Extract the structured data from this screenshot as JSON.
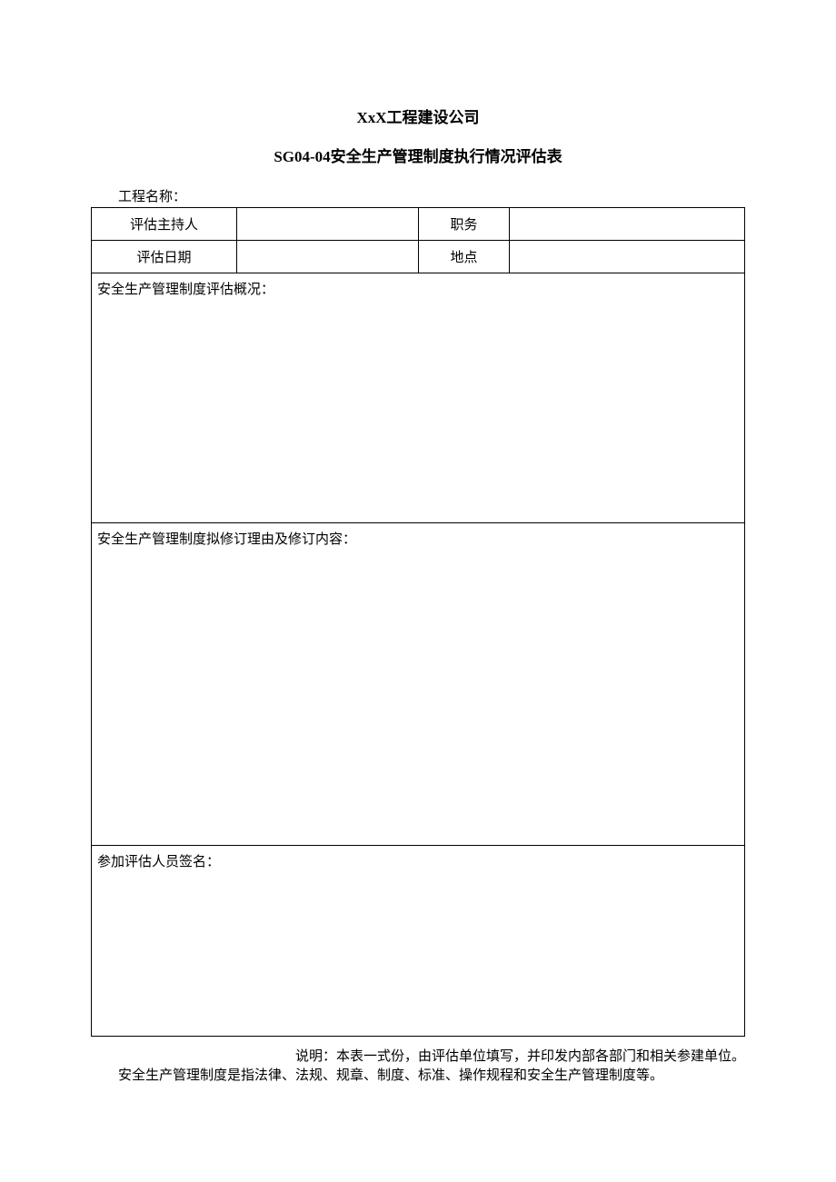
{
  "header": {
    "company": "XxX工程建设公司",
    "form_code": "SG04-04",
    "form_title": "安全生产管理制度执行情况评估表"
  },
  "labels": {
    "project_name": "工程名称：",
    "evaluator": "评估主持人",
    "position": "职务",
    "eval_date": "评估日期",
    "location": "地点",
    "section1": "安全生产管理制度评估概况：",
    "section2": "安全生产管理制度拟修订理由及修订内容：",
    "section3": "参加评估人员签名：",
    "footnote_line1": "说明：本表一式份，由评估单位填写，并印发内部各部门和相关参建单位。",
    "footnote_line2": "安全生产管理制度是指法律、法规、规章、制度、标准、操作规程和安全生产管理制度等。"
  },
  "values": {
    "project_name": "",
    "evaluator": "",
    "position": "",
    "eval_date": "",
    "location": "",
    "section1": "",
    "section2": "",
    "section3": ""
  }
}
